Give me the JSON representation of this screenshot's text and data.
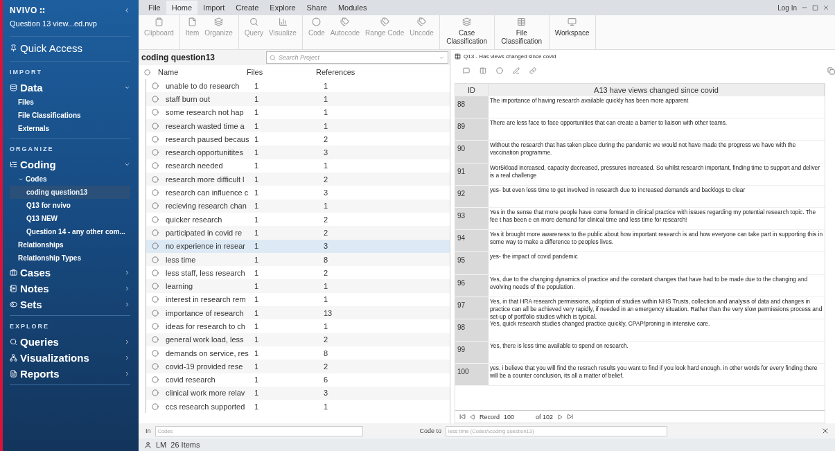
{
  "sidebar": {
    "logo": "NVIVO",
    "project": "Question 13 view...ed.nvp",
    "quick_access": "Quick Access",
    "sections": [
      {
        "heading": "IMPORT",
        "groups": [
          {
            "label": "Data",
            "expanded": true,
            "children": [
              {
                "label": "Files",
                "selected": false
              },
              {
                "label": "File Classifications",
                "selected": false
              },
              {
                "label": "Externals",
                "selected": false
              }
            ]
          }
        ]
      },
      {
        "heading": "ORGANIZE",
        "groups": [
          {
            "label": "Coding",
            "expanded": true,
            "children": [
              {
                "label": "Codes",
                "selected": false,
                "expanded": true,
                "children": [
                  {
                    "label": "coding question13",
                    "selected": true
                  },
                  {
                    "label": "Q13 for nvivo",
                    "selected": false
                  },
                  {
                    "label": "Q13 NEW",
                    "selected": false
                  },
                  {
                    "label": "Question 14 - any other com...",
                    "selected": false
                  }
                ]
              },
              {
                "label": "Relationships",
                "selected": false
              },
              {
                "label": "Relationship Types",
                "selected": false
              }
            ]
          },
          {
            "label": "Cases",
            "expanded": false
          },
          {
            "label": "Notes",
            "expanded": false
          },
          {
            "label": "Sets",
            "expanded": false
          }
        ]
      },
      {
        "heading": "EXPLORE",
        "groups": [
          {
            "label": "Queries",
            "expanded": false
          },
          {
            "label": "Visualizations",
            "expanded": false
          },
          {
            "label": "Reports",
            "expanded": false
          }
        ]
      }
    ]
  },
  "menu": {
    "tabs": [
      {
        "label": "File",
        "selected": false
      },
      {
        "label": "Home",
        "selected": true
      },
      {
        "label": "Import",
        "selected": false
      },
      {
        "label": "Create",
        "selected": false
      },
      {
        "label": "Explore",
        "selected": false
      },
      {
        "label": "Share",
        "selected": false
      },
      {
        "label": "Modules",
        "selected": false
      }
    ],
    "login": "Log In"
  },
  "ribbon": [
    [
      "Clipboard"
    ],
    [
      "Item",
      "Organize"
    ],
    [
      "Query",
      "Visualize"
    ],
    [
      "Code",
      "Autocode",
      "Range Code",
      "Uncode"
    ],
    [
      "Case Classification"
    ],
    [
      "File Classification"
    ],
    [
      "Workspace"
    ]
  ],
  "codes": {
    "title": "coding question13",
    "search_placeholder": "Search Project",
    "columns": [
      "Name",
      "Files",
      "References"
    ],
    "rows": [
      {
        "name": "unable to do research",
        "files": "1",
        "refs": "1",
        "selected": false
      },
      {
        "name": "staff burn out",
        "files": "1",
        "refs": "1",
        "selected": false
      },
      {
        "name": "some research not hap",
        "files": "1",
        "refs": "1",
        "selected": false
      },
      {
        "name": "research wasted time a",
        "files": "1",
        "refs": "1",
        "selected": false
      },
      {
        "name": "research paused becaus",
        "files": "1",
        "refs": "2",
        "selected": false
      },
      {
        "name": "research opportunitites",
        "files": "1",
        "refs": "3",
        "selected": false
      },
      {
        "name": "research needed",
        "files": "1",
        "refs": "1",
        "selected": false
      },
      {
        "name": "research more difficult l",
        "files": "1",
        "refs": "2",
        "selected": false
      },
      {
        "name": "research can influence c",
        "files": "1",
        "refs": "3",
        "selected": false
      },
      {
        "name": "recieving research chan",
        "files": "1",
        "refs": "1",
        "selected": false
      },
      {
        "name": "quicker research",
        "files": "1",
        "refs": "2",
        "selected": false
      },
      {
        "name": "participated in covid re",
        "files": "1",
        "refs": "2",
        "selected": false
      },
      {
        "name": "no experience in resear",
        "files": "1",
        "refs": "3",
        "selected": true
      },
      {
        "name": "less time",
        "files": "1",
        "refs": "8",
        "selected": false
      },
      {
        "name": "less staff, less research",
        "files": "1",
        "refs": "2",
        "selected": false
      },
      {
        "name": "learning",
        "files": "1",
        "refs": "1",
        "selected": false
      },
      {
        "name": "interest in research rem",
        "files": "1",
        "refs": "1",
        "selected": false
      },
      {
        "name": "importance of research",
        "files": "1",
        "refs": "13",
        "selected": false
      },
      {
        "name": "ideas for research to ch",
        "files": "1",
        "refs": "1",
        "selected": false
      },
      {
        "name": "general work load, less",
        "files": "1",
        "refs": "2",
        "selected": false
      },
      {
        "name": "demands on service, res",
        "files": "1",
        "refs": "8",
        "selected": false
      },
      {
        "name": "covid-19 provided rese",
        "files": "1",
        "refs": "2",
        "selected": false
      },
      {
        "name": "covid research",
        "files": "1",
        "refs": "6",
        "selected": false
      },
      {
        "name": "clinical work more relav",
        "files": "1",
        "refs": "3",
        "selected": false
      },
      {
        "name": "ccs research supported",
        "files": "1",
        "refs": "1",
        "selected": false
      }
    ]
  },
  "dataset": {
    "tab": "Q13 - Has views changed since covid",
    "columns": [
      "ID",
      "A13 have views changed since covid"
    ],
    "rows": [
      {
        "id": "88",
        "text": "The importance of having research available quickly has been more apparent"
      },
      {
        "id": "89",
        "text": "There are less face to face opportunities that can create a barrier to liaison with other teams."
      },
      {
        "id": "90",
        "text": "Without the research that has taken place during the pandemic we would not have made the progress we have with the vaccination programme."
      },
      {
        "id": "91",
        "text": "Wor5kload increased, capacity decreased, pressures increased. So whilst research important, finding time to support and deliver is a real challenge"
      },
      {
        "id": "92",
        "text": "yes- but even less time to get involved in research due to increased demands and backlogs to clear"
      },
      {
        "id": "93",
        "text": "Yes in the sense that more people have come forward in clinical practice with issues regarding my potential research topic. The fee t has been e en more demand for clinical time and less time for research!"
      },
      {
        "id": "94",
        "text": "Yes it brought more awareness to the public about how important research is and how everyone can take part in supporting this in some way to make a difference to peoples lives."
      },
      {
        "id": "95",
        "text": "yes- the impact of covid pandemic"
      },
      {
        "id": "96",
        "text": "Yes, due to the changing dynamics of practice and the constant changes that have had to be made due to the changing and evolving needs of the population."
      },
      {
        "id": "97",
        "text": "Yes, in that HRA research permissions, adoption of studies within NHS Trusts,  collection and analysis of data and changes in practice can all be achieved very rapidly, if needed in an emergency situation. Rather than the very slow permissions process and set-up of portfolio studies which is typical."
      },
      {
        "id": "98",
        "text": "Yes, quick research studies changed practice quickly, CPAP/proning in intensive care."
      },
      {
        "id": "99",
        "text": "Yes, there is less time available to spend on research."
      },
      {
        "id": "100",
        "text": "yes. i believe that you will find the resrach results you want to find if you look hard enough. in other words for every finding there will be a counter conclusion, its all a matter of belief."
      }
    ],
    "record_label": "Record",
    "record": "100",
    "record_total": "of 102"
  },
  "code_bar": {
    "in_label": "In",
    "in_placeholder": "Codes",
    "code_to_label": "Code to",
    "code_to_value": "less time (Codes\\\\coding question13)"
  },
  "status": {
    "user": "LM",
    "items": "26 Items"
  }
}
